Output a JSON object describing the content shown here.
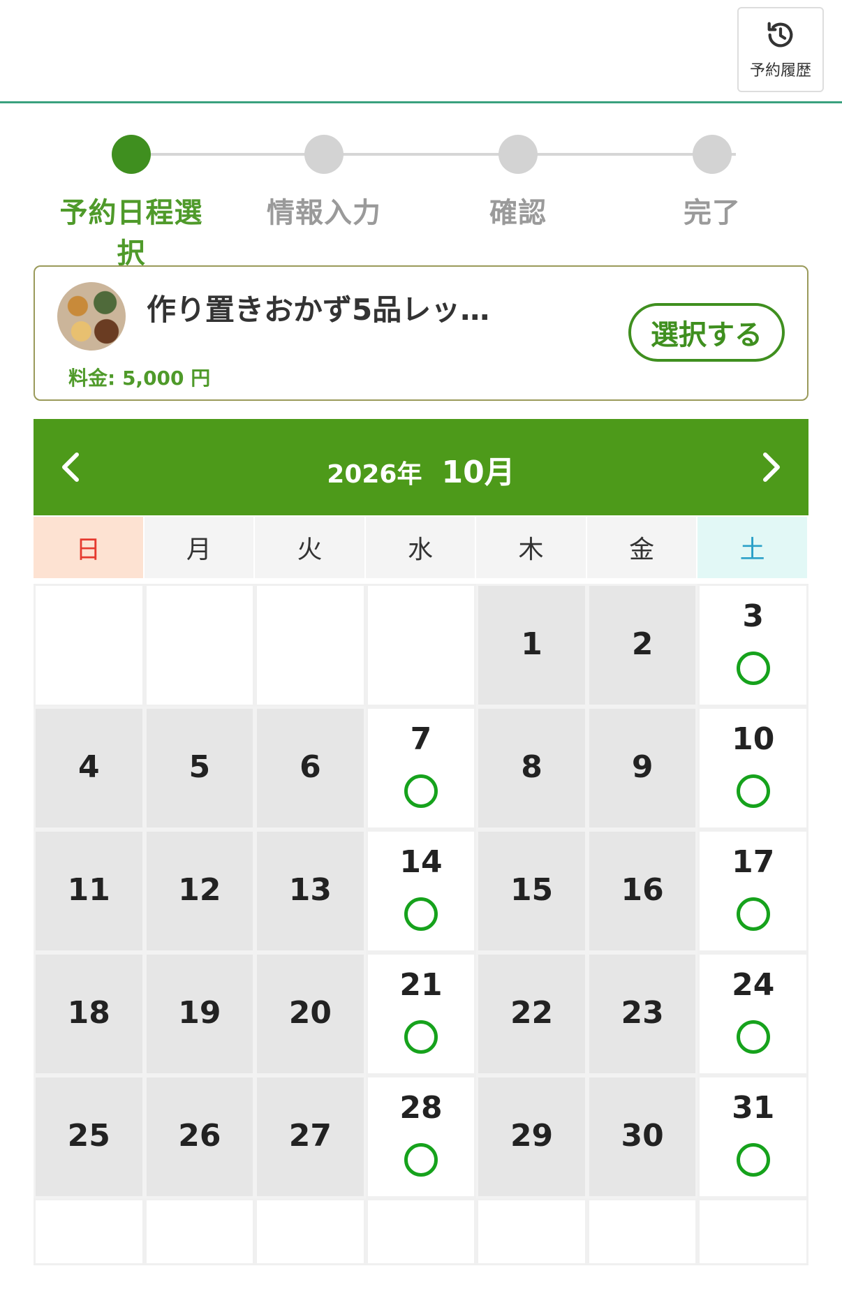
{
  "header": {
    "history_label": "予約履歴",
    "history_icon": "history-icon",
    "border_color": "#3aa17e"
  },
  "stepper": {
    "steps": [
      {
        "label": "予約日程選択",
        "active": true
      },
      {
        "label": "情報入力",
        "active": false
      },
      {
        "label": "確認",
        "active": false
      },
      {
        "label": "完了",
        "active": false
      }
    ]
  },
  "plan": {
    "title": "作り置きおかず5品レッ…",
    "price": "料金: 5,000 円",
    "select_label": "選択する",
    "thumbnail_icon": "food-thumbnail"
  },
  "calendar": {
    "year": "2026年",
    "month": "10月",
    "prev_icon": "chevron-left-icon",
    "next_icon": "chevron-right-icon",
    "weekdays": [
      "日",
      "月",
      "火",
      "水",
      "木",
      "金",
      "土"
    ],
    "weeks": [
      [
        {
          "day": "",
          "status": "empty"
        },
        {
          "day": "",
          "status": "empty"
        },
        {
          "day": "",
          "status": "empty"
        },
        {
          "day": "",
          "status": "empty"
        },
        {
          "day": "1",
          "status": "off"
        },
        {
          "day": "2",
          "status": "off"
        },
        {
          "day": "3",
          "status": "avail"
        }
      ],
      [
        {
          "day": "4",
          "status": "off"
        },
        {
          "day": "5",
          "status": "off"
        },
        {
          "day": "6",
          "status": "off"
        },
        {
          "day": "7",
          "status": "avail"
        },
        {
          "day": "8",
          "status": "off"
        },
        {
          "day": "9",
          "status": "off"
        },
        {
          "day": "10",
          "status": "avail"
        }
      ],
      [
        {
          "day": "11",
          "status": "off"
        },
        {
          "day": "12",
          "status": "off"
        },
        {
          "day": "13",
          "status": "off"
        },
        {
          "day": "14",
          "status": "avail"
        },
        {
          "day": "15",
          "status": "off"
        },
        {
          "day": "16",
          "status": "off"
        },
        {
          "day": "17",
          "status": "avail"
        }
      ],
      [
        {
          "day": "18",
          "status": "off"
        },
        {
          "day": "19",
          "status": "off"
        },
        {
          "day": "20",
          "status": "off"
        },
        {
          "day": "21",
          "status": "avail"
        },
        {
          "day": "22",
          "status": "off"
        },
        {
          "day": "23",
          "status": "off"
        },
        {
          "day": "24",
          "status": "avail"
        }
      ],
      [
        {
          "day": "25",
          "status": "off"
        },
        {
          "day": "26",
          "status": "off"
        },
        {
          "day": "27",
          "status": "off"
        },
        {
          "day": "28",
          "status": "avail"
        },
        {
          "day": "29",
          "status": "off"
        },
        {
          "day": "30",
          "status": "off"
        },
        {
          "day": "31",
          "status": "avail"
        }
      ],
      [
        {
          "day": "",
          "status": "empty"
        },
        {
          "day": "",
          "status": "empty"
        },
        {
          "day": "",
          "status": "empty"
        },
        {
          "day": "",
          "status": "empty"
        },
        {
          "day": "",
          "status": "empty"
        },
        {
          "day": "",
          "status": "empty"
        },
        {
          "day": "",
          "status": "empty"
        }
      ]
    ],
    "colors": {
      "header_bg": "#4d9a1a",
      "available_mark": "#16a21c",
      "unavailable_bg": "#e6e6e6",
      "sunday": "#e53a2e",
      "saturday": "#2aa0c8"
    }
  }
}
